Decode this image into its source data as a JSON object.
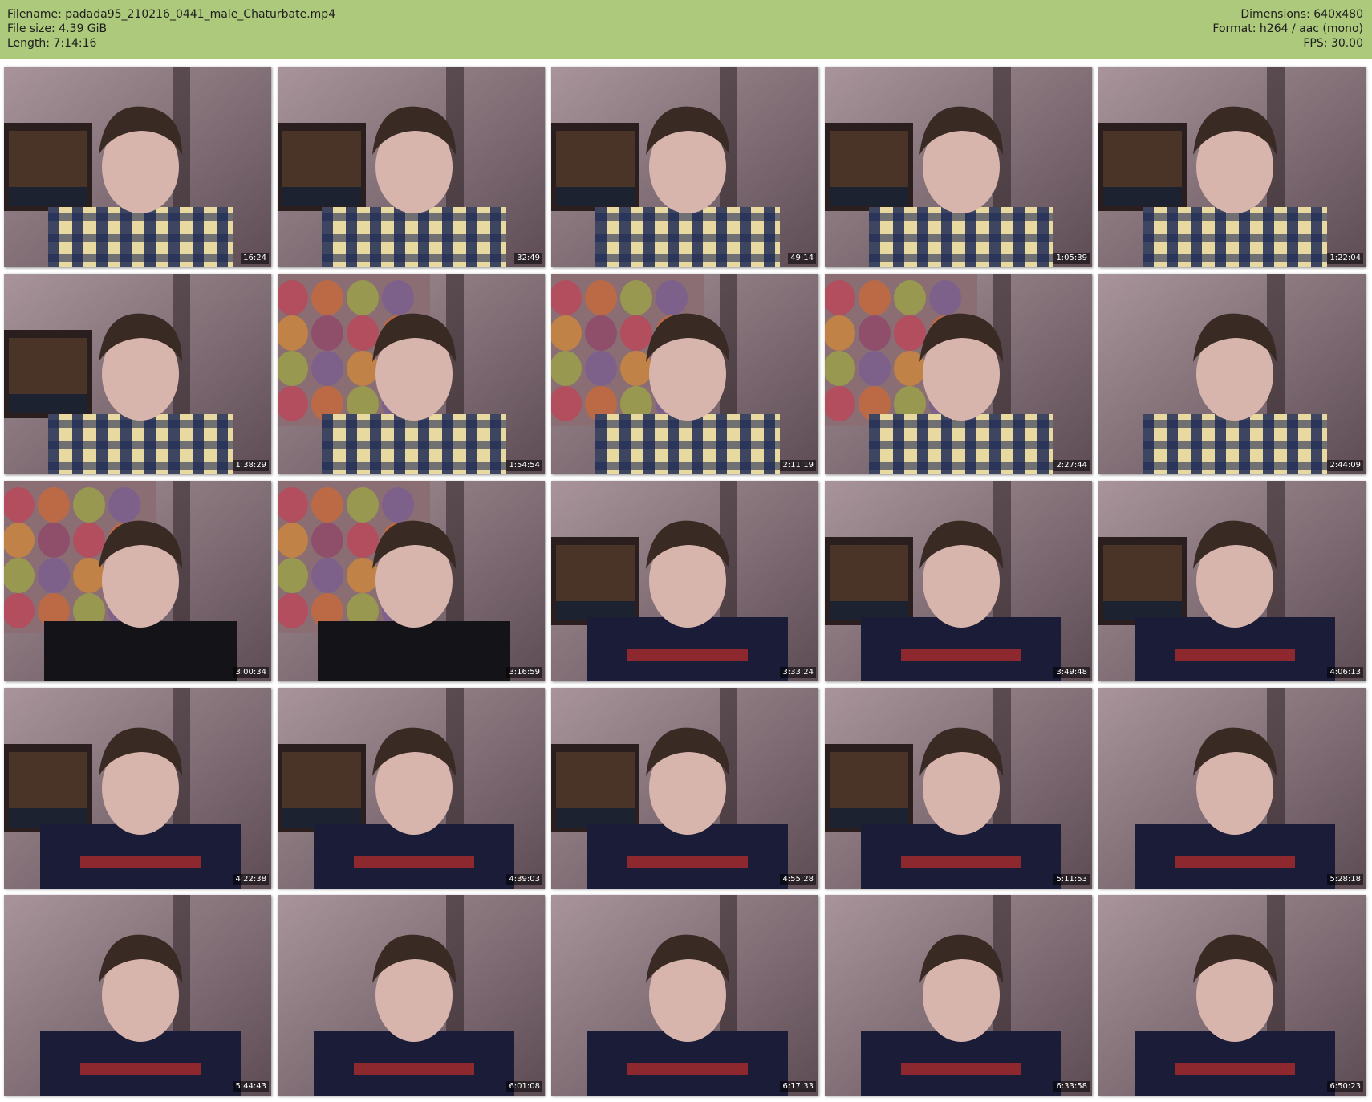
{
  "header": {
    "filename": "Filename: padada95_210216_0441_male_Chaturbate.mp4",
    "file_size": "File size: 4.39 GiB",
    "length": "Length: 7:14:16",
    "dimensions": "Dimensions: 640x480",
    "format": "Format: h264 / aac (mono)",
    "fps": "FPS: 30.00"
  },
  "colors": {
    "header_bg": "#adc97c"
  },
  "thumbnails": [
    {
      "time": "16:24",
      "bg": "frame",
      "top": "plaid"
    },
    {
      "time": "32:49",
      "bg": "frame",
      "top": "plaid"
    },
    {
      "time": "49:14",
      "bg": "frame",
      "top": "plaid"
    },
    {
      "time": "1:05:39",
      "bg": "frame",
      "top": "plaid"
    },
    {
      "time": "1:22:04",
      "bg": "frame",
      "top": "plaid"
    },
    {
      "time": "1:38:29",
      "bg": "frame",
      "top": "plaid"
    },
    {
      "time": "1:54:54",
      "bg": "colorful",
      "top": "plaid"
    },
    {
      "time": "2:11:19",
      "bg": "colorful",
      "top": "plaid"
    },
    {
      "time": "2:27:44",
      "bg": "colorful",
      "top": "plaid"
    },
    {
      "time": "2:44:09",
      "bg": "plain",
      "top": "plaid"
    },
    {
      "time": "3:00:34",
      "bg": "colorful",
      "top": "black"
    },
    {
      "time": "3:16:59",
      "bg": "colorful",
      "top": "black"
    },
    {
      "time": "3:33:24",
      "bg": "frame",
      "top": "hoodie"
    },
    {
      "time": "3:49:48",
      "bg": "frame",
      "top": "hoodie"
    },
    {
      "time": "4:06:13",
      "bg": "frame",
      "top": "hoodie"
    },
    {
      "time": "4:22:38",
      "bg": "frame",
      "top": "hoodie"
    },
    {
      "time": "4:39:03",
      "bg": "frame",
      "top": "hoodie"
    },
    {
      "time": "4:55:28",
      "bg": "frame",
      "top": "hoodie"
    },
    {
      "time": "5:11:53",
      "bg": "frame",
      "top": "hoodie"
    },
    {
      "time": "5:28:18",
      "bg": "plain",
      "top": "hoodie"
    },
    {
      "time": "5:44:43",
      "bg": "plain",
      "top": "hoodie"
    },
    {
      "time": "6:01:08",
      "bg": "plain",
      "top": "hoodie"
    },
    {
      "time": "6:17:33",
      "bg": "plain",
      "top": "hoodie"
    },
    {
      "time": "6:33:58",
      "bg": "plain",
      "top": "hoodie"
    },
    {
      "time": "6:50:23",
      "bg": "plain",
      "top": "hoodie"
    }
  ]
}
